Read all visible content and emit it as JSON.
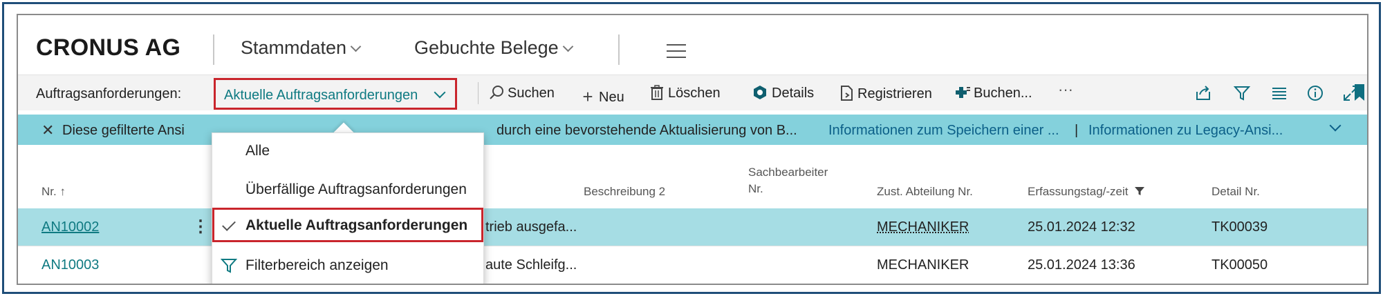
{
  "header": {
    "brand": "CRONUS AG",
    "nav": [
      {
        "label": "Stammdaten"
      },
      {
        "label": "Gebuchte Belege"
      }
    ]
  },
  "actionbar": {
    "label": "Auftragsanforderungen:",
    "view": "Aktuelle Auftragsanforderungen",
    "actions": [
      {
        "label": "Suchen",
        "icon": "search-icon"
      },
      {
        "label": "Neu",
        "icon": "plus-icon"
      },
      {
        "label": "Löschen",
        "icon": "trash-icon"
      },
      {
        "label": "Details",
        "icon": "details-icon"
      },
      {
        "label": "Registrieren",
        "icon": "register-icon"
      },
      {
        "label": "Buchen...",
        "icon": "post-icon"
      }
    ],
    "more": "···"
  },
  "infobar": {
    "text": "Diese gefilterte Ansi",
    "text_tail": "durch eine bevorstehende Aktualisierung von B...",
    "link1": "Informationen zum Speichern einer ...",
    "separator": "|",
    "link2": "Informationen zu Legacy-Ansi..."
  },
  "table": {
    "headers": {
      "nr": "Nr. ↑",
      "beschreibung2": "Beschreibung 2",
      "sachbearbeiter_line1": "Sachbearbeiter",
      "sachbearbeiter_line2": "Nr.",
      "abteilung": "Zust. Abteilung Nr.",
      "erfassung": "Erfassungstag/-zeit",
      "detail": "Detail Nr."
    },
    "rows": [
      {
        "nr": "AN10002",
        "beschreibung": "trieb ausgefa...",
        "abteilung": "MECHANIKER",
        "erfassung": "25.01.2024 12:32",
        "detail": "TK00039"
      },
      {
        "nr": "AN10003",
        "beschreibung": "aute Schleifg...",
        "abteilung": "MECHANIKER",
        "erfassung": "25.01.2024 13:36",
        "detail": "TK00050"
      }
    ]
  },
  "dropdown": {
    "items": [
      {
        "label": "Alle"
      },
      {
        "label": "Überfällige Auftragsanforderungen"
      },
      {
        "label": "Aktuelle Auftragsanforderungen"
      },
      {
        "label": "Filterbereich anzeigen"
      }
    ]
  },
  "colors": {
    "accent": "#0f7a82",
    "highlight_border": "#c9252c",
    "infobar_bg": "#84d1dc",
    "selected_row": "#a6dde4"
  }
}
